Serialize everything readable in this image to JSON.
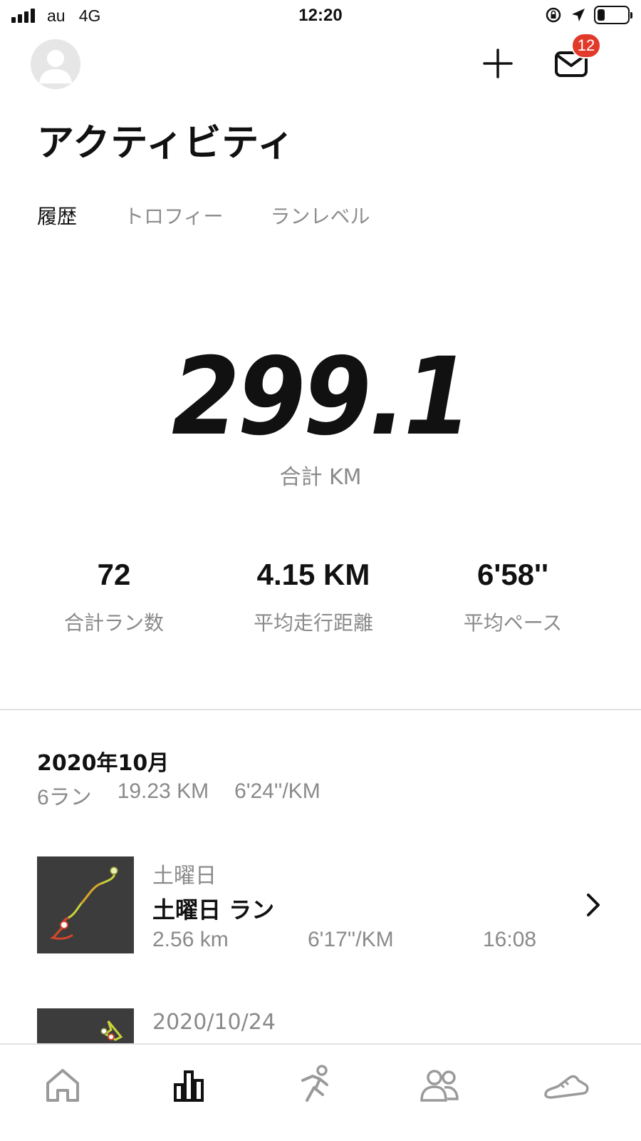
{
  "status_bar": {
    "carrier": "au",
    "network": "4G",
    "time": "12:20",
    "battery_level": 0.25
  },
  "header": {
    "notifications_count": "12"
  },
  "page": {
    "title": "アクティビティ",
    "tabs": [
      {
        "label": "履歴",
        "active": true
      },
      {
        "label": "トロフィー",
        "active": false
      },
      {
        "label": "ランレベル",
        "active": false
      }
    ]
  },
  "summary": {
    "total_value": "299.1",
    "total_label": "合計 KM",
    "stats": [
      {
        "value": "72",
        "label": "合計ラン数"
      },
      {
        "value": "4.15 KM",
        "label": "平均走行距離"
      },
      {
        "value": "6'58''",
        "label": "平均ペース"
      }
    ]
  },
  "month": {
    "title": "2020年10月",
    "runs": "6ラン",
    "distance": "19.23 KM",
    "pace": "6'24''/KM"
  },
  "activities": [
    {
      "day": "土曜日",
      "title": "土曜日 ラン",
      "distance": "2.56 km",
      "pace": "6'17''/KM",
      "time": "16:08"
    },
    {
      "day": "2020/10/24"
    }
  ],
  "tabbar": [
    "home-icon",
    "activity-icon",
    "run-icon",
    "club-icon",
    "shoe-icon"
  ],
  "colors": {
    "accent_badge": "#e13a2a",
    "muted_text": "#8a8a8a",
    "map_bg": "#3c3c3c"
  }
}
